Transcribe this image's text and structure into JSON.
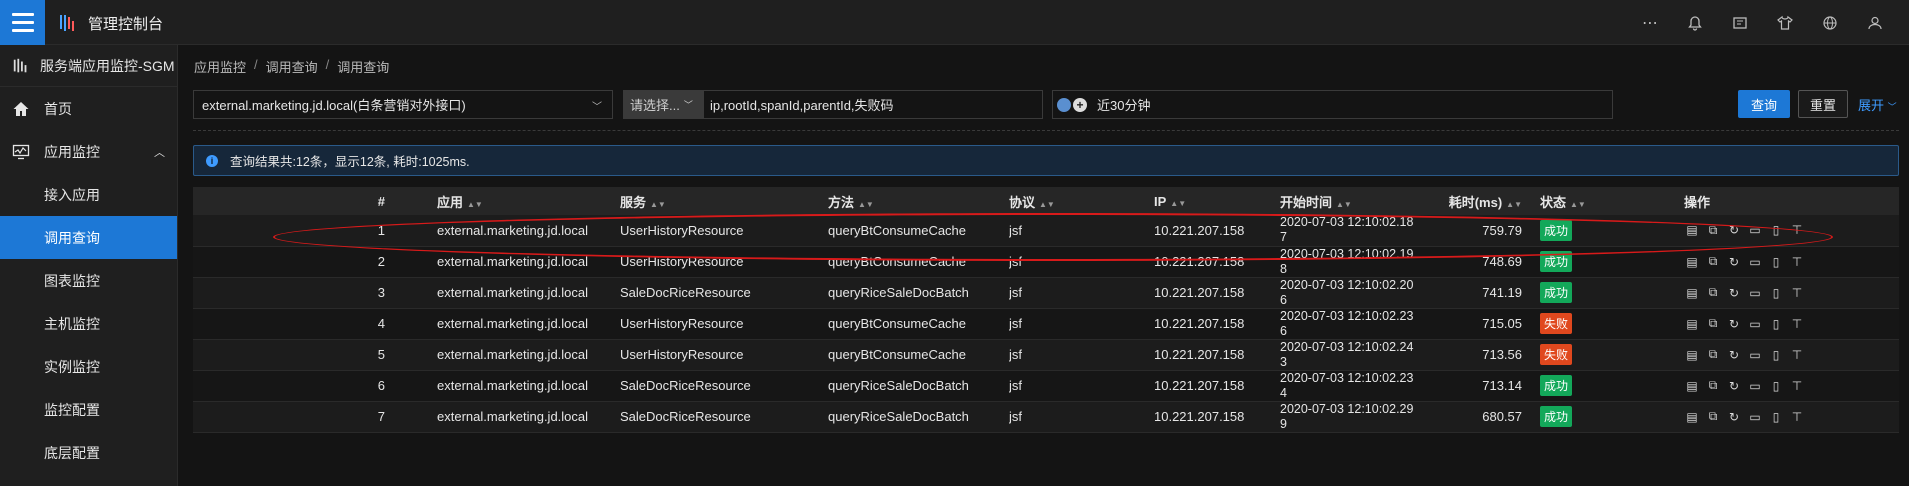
{
  "header": {
    "title": "管理控制台",
    "icons": [
      "more-icon",
      "bell-icon",
      "note-icon",
      "shirt-icon",
      "globe-icon",
      "user-icon"
    ]
  },
  "sidebar": {
    "app_name": "服务端应用监控-SGM",
    "items": [
      {
        "label": "首页",
        "icon": "home-icon"
      },
      {
        "label": "应用监控",
        "icon": "monitor-icon"
      },
      {
        "label": "接入应用"
      },
      {
        "label": "调用查询"
      },
      {
        "label": "图表监控"
      },
      {
        "label": "主机监控"
      },
      {
        "label": "实例监控"
      },
      {
        "label": "监控配置"
      },
      {
        "label": "底层配置"
      }
    ]
  },
  "breadcrumb": [
    "应用监控",
    "调用查询",
    "调用查询"
  ],
  "filters": {
    "app_value": "external.marketing.jd.local(白条营销对外接口)",
    "query_type": "请选择...",
    "query_placeholder": "ip,rootId,spanId,parentId,失败码",
    "time_range": "近30分钟"
  },
  "buttons": {
    "search": "查询",
    "reset": "重置",
    "expand": "展开"
  },
  "info": "查询结果共:12条，显示12条, 耗时:1025ms.",
  "table": {
    "columns": [
      "#",
      "应用",
      "服务",
      "方法",
      "协议",
      "IP",
      "开始时间",
      "耗时(ms)",
      "状态",
      "操作"
    ],
    "rows": [
      {
        "idx": "1",
        "app": "external.marketing.jd.local",
        "service": "UserHistoryResource",
        "method": "queryBtConsumeCache",
        "protocol": "jsf",
        "ip": "10.221.207.158",
        "start": "2020-07-03 12:10:02.187",
        "cost": "759.79",
        "status": "成功",
        "ok": true
      },
      {
        "idx": "2",
        "app": "external.marketing.jd.local",
        "service": "UserHistoryResource",
        "method": "queryBtConsumeCache",
        "protocol": "jsf",
        "ip": "10.221.207.158",
        "start": "2020-07-03 12:10:02.198",
        "cost": "748.69",
        "status": "成功",
        "ok": true
      },
      {
        "idx": "3",
        "app": "external.marketing.jd.local",
        "service": "SaleDocRiceResource",
        "method": "queryRiceSaleDocBatch",
        "protocol": "jsf",
        "ip": "10.221.207.158",
        "start": "2020-07-03 12:10:02.206",
        "cost": "741.19",
        "status": "成功",
        "ok": true
      },
      {
        "idx": "4",
        "app": "external.marketing.jd.local",
        "service": "UserHistoryResource",
        "method": "queryBtConsumeCache",
        "protocol": "jsf",
        "ip": "10.221.207.158",
        "start": "2020-07-03 12:10:02.236",
        "cost": "715.05",
        "status": "失败",
        "ok": false
      },
      {
        "idx": "5",
        "app": "external.marketing.jd.local",
        "service": "UserHistoryResource",
        "method": "queryBtConsumeCache",
        "protocol": "jsf",
        "ip": "10.221.207.158",
        "start": "2020-07-03 12:10:02.243",
        "cost": "713.56",
        "status": "失败",
        "ok": false
      },
      {
        "idx": "6",
        "app": "external.marketing.jd.local",
        "service": "SaleDocRiceResource",
        "method": "queryRiceSaleDocBatch",
        "protocol": "jsf",
        "ip": "10.221.207.158",
        "start": "2020-07-03 12:10:02.234",
        "cost": "713.14",
        "status": "成功",
        "ok": true
      },
      {
        "idx": "7",
        "app": "external.marketing.jd.local",
        "service": "SaleDocRiceResource",
        "method": "queryRiceSaleDocBatch",
        "protocol": "jsf",
        "ip": "10.221.207.158",
        "start": "2020-07-03 12:10:02.299",
        "cost": "680.57",
        "status": "成功",
        "ok": true
      }
    ]
  },
  "colors": {
    "accent": "#1d78d6",
    "success": "#13a85a",
    "fail": "#e0481e",
    "annotation": "#d81a1a"
  }
}
